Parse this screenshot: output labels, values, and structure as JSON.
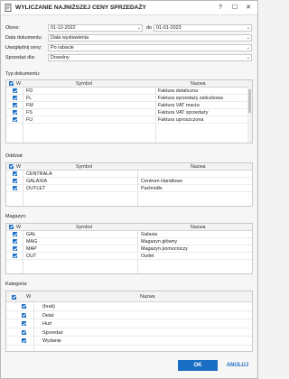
{
  "window": {
    "title": "WYLICZANIE NAJNIŻSZEJ CENY SPRZEDAŻY",
    "help_glyph": "?",
    "max_glyph": "☐",
    "close_glyph": "✕"
  },
  "filters": {
    "period_label": "Okres:",
    "period_from": "01-12-2022",
    "period_to_label": "do",
    "period_to": "01-01-2023",
    "doc_date_label": "Data dokumentu:",
    "doc_date_value": "Data wystawienia",
    "include_prices_label": "Uwzględnij ceny:",
    "include_prices_value": "Po rabacie",
    "sale_for_label": "Sprzedaż dla:",
    "sale_for_value": "Dowolny"
  },
  "doc_types": {
    "section_label": "Typ dokumentu:",
    "headers": {
      "w": "W",
      "symbol": "Symbol",
      "name": "Nazwa"
    },
    "rows": [
      {
        "symbol": "FD",
        "name": "Faktura detaliczna"
      },
      {
        "symbol": "FL",
        "name": "Faktura sprzedaży zaliczkowa"
      },
      {
        "symbol": "FM",
        "name": "Faktura VAT marża"
      },
      {
        "symbol": "FS",
        "name": "Faktura VAT sprzedaży"
      },
      {
        "symbol": "FU",
        "name": "Faktura uproszczona"
      }
    ]
  },
  "branch": {
    "section_label": "Oddział:",
    "headers": {
      "w": "W",
      "symbol": "Symbol",
      "name": "Nazwa"
    },
    "rows": [
      {
        "symbol": "CENTRALA",
        "name": ""
      },
      {
        "symbol": "GALAXIA",
        "name": "Centrum Handlowe"
      },
      {
        "symbol": "OUTLET",
        "name": "Pachnidło"
      }
    ]
  },
  "warehouse": {
    "section_label": "Magazyn:",
    "headers": {
      "w": "W",
      "symbol": "Symbol",
      "name": "Nazwa"
    },
    "rows": [
      {
        "symbol": "GAL",
        "name": "Galaxia"
      },
      {
        "symbol": "MAG",
        "name": "Magazyn główny"
      },
      {
        "symbol": "MAP",
        "name": "Magazyn pomocniczy"
      },
      {
        "symbol": "OUT",
        "name": "Outlet"
      }
    ]
  },
  "category": {
    "section_label": "Kategoria:",
    "headers": {
      "w": "W",
      "name": "Nazwa"
    },
    "rows": [
      {
        "name": "(brak)"
      },
      {
        "name": "Detal"
      },
      {
        "name": "Hurt"
      },
      {
        "name": "Sprzedaż"
      },
      {
        "name": "Wydanie"
      }
    ]
  },
  "actions": {
    "ok": "OK",
    "cancel": "ANULUJ"
  },
  "colors": {
    "accent": "#1a6ec4",
    "background": "#f6f6f6"
  }
}
